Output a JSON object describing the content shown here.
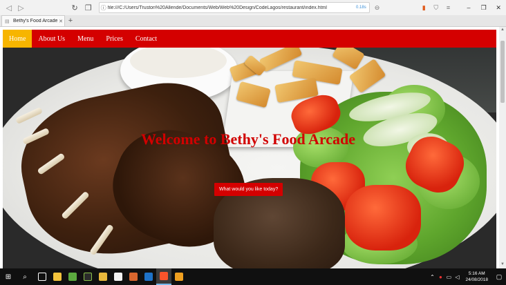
{
  "browser": {
    "url": "file:///C:/Users/Truston%20Allende/Documents/Web/Web%20Design/CodeLagos/restaurant/index.html",
    "zoom": "0.18s",
    "tab_title": "Bethy's Food Arcade",
    "new_tab_label": "+"
  },
  "site": {
    "nav": [
      {
        "label": "Home",
        "active": true
      },
      {
        "label": "About Us"
      },
      {
        "label": "Menu"
      },
      {
        "label": "Prices"
      },
      {
        "label": "Contact"
      }
    ],
    "hero_title": "Welcome to Bethy's Food Arcade",
    "cta_label": "What would you like today?",
    "colors": {
      "nav_bg": "#d40000",
      "active_bg": "#f7b500",
      "title": "#d10000"
    }
  },
  "taskbar": {
    "time": "5:16 AM",
    "date": "24/08/2018"
  }
}
